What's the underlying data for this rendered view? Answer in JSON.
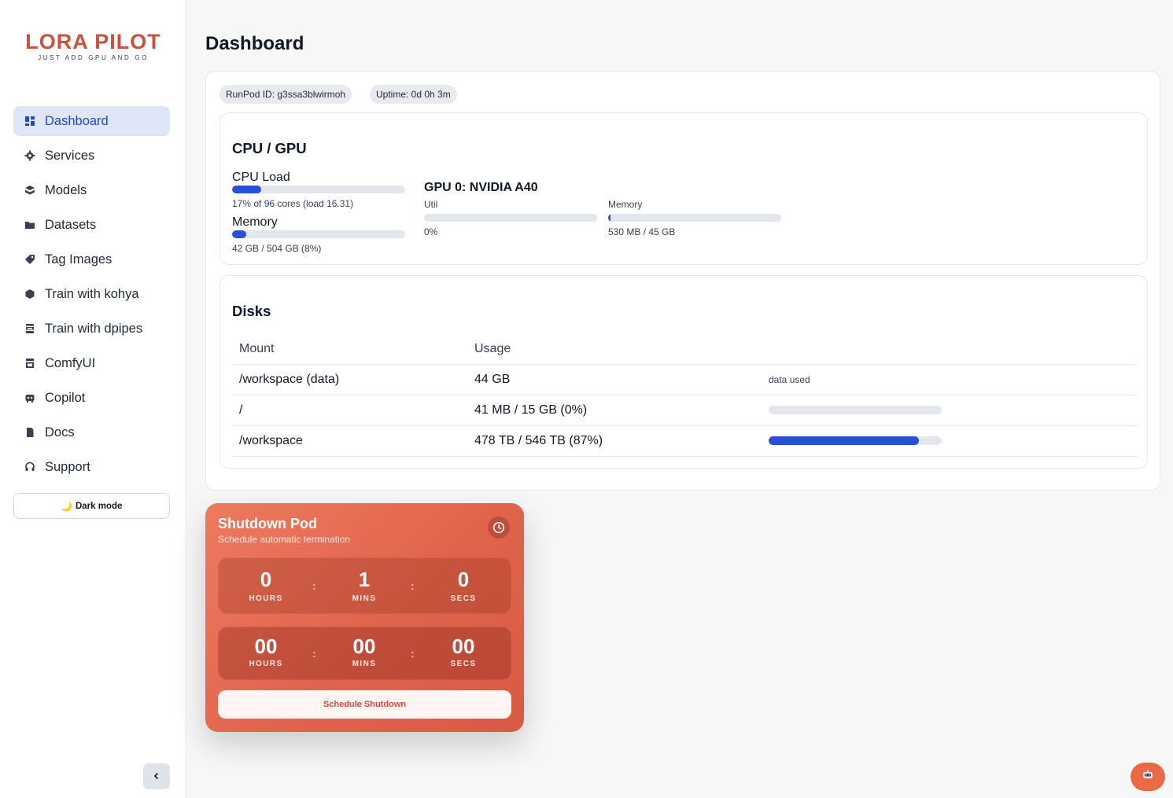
{
  "brand": {
    "title": "LORA PILOT",
    "tagline": "JUST ADD GPU AND GO",
    "accent": "#c9513f"
  },
  "sidebar": {
    "items": [
      {
        "label": "Dashboard",
        "icon": "dashboard-icon",
        "active": true
      },
      {
        "label": "Services",
        "icon": "gear-icon"
      },
      {
        "label": "Models",
        "icon": "layers-icon"
      },
      {
        "label": "Datasets",
        "icon": "folder-icon"
      },
      {
        "label": "Tag Images",
        "icon": "tag-icon"
      },
      {
        "label": "Train with kohya",
        "icon": "hexagon-icon"
      },
      {
        "label": "Train with dpipes",
        "icon": "stack-icon"
      },
      {
        "label": "ComfyUI",
        "icon": "inbox-icon"
      },
      {
        "label": "Copilot",
        "icon": "robot-icon"
      },
      {
        "label": "Docs",
        "icon": "document-icon"
      },
      {
        "label": "Support",
        "icon": "headset-icon"
      }
    ],
    "dark_mode_label": "Dark mode"
  },
  "page": {
    "title": "Dashboard"
  },
  "status": {
    "runpod": "RunPod ID: g3ssa3blwirmoh",
    "uptime": "Uptime: 0d 0h 3m"
  },
  "cpu_gpu": {
    "title": "CPU / GPU",
    "cpu_load_label": "CPU Load",
    "cpu_load_fraction": 0.17,
    "cpu_load_text": "17% of 96 cores (load 16.31)",
    "memory_label": "Memory",
    "memory_fraction": 0.08,
    "memory_text": "42 GB / 504 GB (8%)",
    "gpu_name": "GPU 0: NVIDIA A40",
    "gpu_util_label": "Util",
    "gpu_util_fraction": 0,
    "gpu_util_text": "0%",
    "gpu_mem_label": "Memory",
    "gpu_mem_fraction": 0.012,
    "gpu_mem_text": "530 MB / 45 GB"
  },
  "disks": {
    "title": "Disks",
    "headers": {
      "mount": "Mount",
      "usage": "Usage"
    },
    "rows": [
      {
        "mount": "/workspace (data)",
        "usage": "44 GB",
        "note": "data used"
      },
      {
        "mount": "/",
        "usage": "41 MB / 15 GB (0%)",
        "fraction": 0
      },
      {
        "mount": "/workspace",
        "usage": "478 TB / 546 TB (87%)",
        "fraction": 0.87
      }
    ]
  },
  "shutdown": {
    "title": "Shutdown Pod",
    "subtitle": "Schedule automatic termination",
    "input": {
      "hours": "0",
      "mins": "1",
      "secs": "0"
    },
    "countdown": {
      "hours": "00",
      "mins": "00",
      "secs": "00"
    },
    "units": {
      "hours": "HOURS",
      "mins": "MINS",
      "secs": "SECS"
    },
    "separator": ":",
    "button_label": "Schedule Shutdown"
  }
}
